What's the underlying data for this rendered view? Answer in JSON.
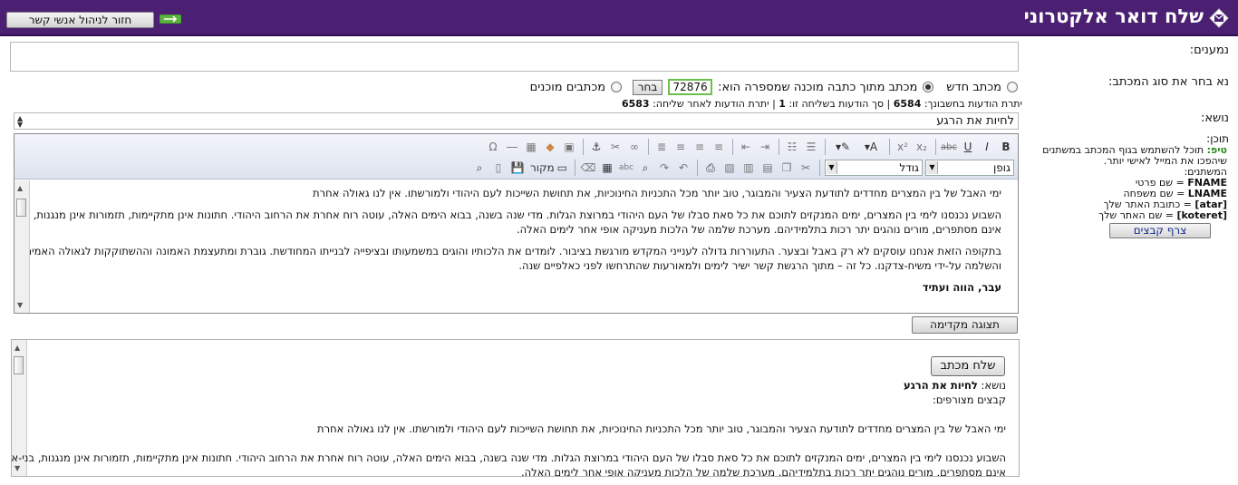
{
  "header": {
    "title": "שלח דואר אלקטרוני",
    "back_label": "חזור לניהול אנשי קשר"
  },
  "form": {
    "recipients_label": "נמענים:",
    "recipients_value": "",
    "type_label": "נא בחר את סוג המכתב:",
    "subject_label": "נושא:",
    "content_label": "תוכן:",
    "new_letter": "מכתב חדש",
    "template_letter": "מכתב מתוך כתבה מוכנה שמספרה הוא:",
    "template_number": "72876",
    "choose_label": "בחר",
    "ready_letters": "מכתבים מוכנים",
    "subject_value": "לחיות את הרגע"
  },
  "quota": {
    "balance_label": "יתרת הודעות בחשבונך:",
    "balance": "6584",
    "sending_label": "סך הודעות בשליחה זו:",
    "sending": "1",
    "after_label": "יתרת הודעות לאחר שליחה:",
    "after": "6583"
  },
  "tips": {
    "tip_word": "טיפ:",
    "tip_text": "תוכל להשתמש בגוף המכתב במשתנים שיהפכו את המייל לאישי יותר.",
    "vars_title": "המשתנים:",
    "v1_key": "FNAME",
    "v1_desc": "= שם פרטי",
    "v2_key": "LNAME",
    "v2_desc": "= שם משפחה",
    "v3_key": "[atar]",
    "v3_desc": "= כתובת האתר שלך",
    "v4_key": "[koteret]",
    "v4_desc": "= שם האתר שלך",
    "attach_label": "צרף קבצים"
  },
  "toolbar": {
    "font_label": "גופן",
    "size_label": "גודל",
    "source_label": "מקור"
  },
  "body": {
    "p1": "ימי האבל של בין המצרים מחדדים לתודעת הצעיר והמבוגר, טוב יותר מכל התכניות החינוכיות, את תחושת השייכות לעם היהודי ולמורשתו. אין לנו גאולה אחרת",
    "p2a": "השבוע נכנסנו לימי בין המצרים,  ימים המנקזים לתוכם את כל סאת סבלו של העם היהודי במרוצת הגלות.  מדי שנה בשנה, בבוא הימים האלה,  עוטה רוח אחרת את הרחוב היהודי.  חתונות אינן מתקיימות,  תזמורות אינן מנגנות, בני-אדם",
    "p2b": "אינם מסתפרים, מורים נוהגים יתר רכות בתלמידיהם. מערכת שלמה של הלכות מעניקה אופי אחר לימים האלה.",
    "p3a": "בתקופה הזאת אנחנו עוסקים לא רק באבל ובצער.  התעוררות גדולה לענייני המקדש מורגשת בציבור.  לומדים את הלכותיו והוגים במשמעותו ובציפייה לבנייתו המחודשת.  גוברת ומתעצמת האמונה וההשתוקקות לגאולה האמיתית",
    "p3b": "והשלמה על-ידי משיח-צדקנו. כל זה – מתוך הרגשת קשר ישיר לימים ולמאורעות שהתרחשו לפני כאלפיים שנה.",
    "heading": "עבר, הווה ועתיד"
  },
  "preview": {
    "button": "תצוגה מקדימה",
    "send_label": "שלח מכתב",
    "subject_prefix": "נושא:",
    "subject_value": "לחיות את הרגע",
    "attachments": "קבצים מצורפים:"
  },
  "colors": {
    "header_bg": "#4b2073",
    "tip_green": "#2a8a1a",
    "input_green": "#6cbf4a"
  }
}
